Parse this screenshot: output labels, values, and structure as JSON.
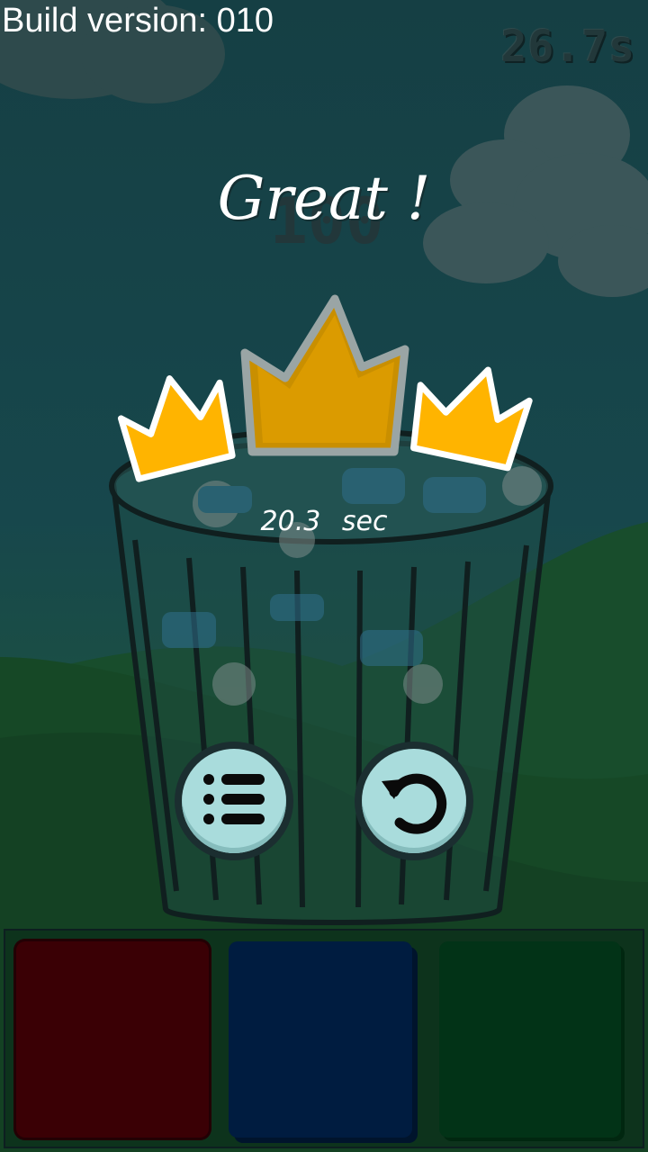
{
  "hud": {
    "build_version": "Build version: 010",
    "timer": "26.7s",
    "background_score": "100"
  },
  "result": {
    "title": "Great !",
    "time_value": "20.3",
    "time_unit": "sec",
    "crowns_earned": 3,
    "crowns_total": 3
  },
  "buttons": {
    "menu_icon": "list-icon",
    "retry_icon": "restart-icon"
  },
  "bins": [
    {
      "color": "#3a0005"
    },
    {
      "color": "#001c40"
    },
    {
      "color": "#023317"
    }
  ],
  "colors": {
    "crown_gold": "#ffb400",
    "crown_outline": "#ffffff",
    "button_face": "#a9dcdc"
  }
}
